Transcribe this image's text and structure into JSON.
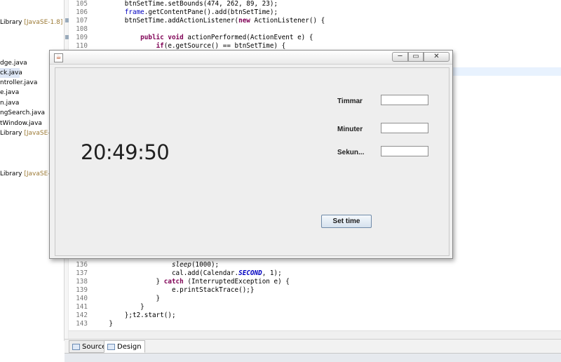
{
  "explorer": {
    "items": [
      {
        "text": " Library ",
        "lib": "[JavaSE-1.8]"
      },
      {
        "text": "dge.java",
        "lib": ""
      },
      {
        "text": "ck.java",
        "lib": ""
      },
      {
        "text": "ntroller.java",
        "lib": ""
      },
      {
        "text": "e.java",
        "lib": ""
      },
      {
        "text": "n.java",
        "lib": ""
      },
      {
        "text": "ngSearch.java",
        "lib": ""
      },
      {
        "text": "tWindow.java",
        "lib": ""
      },
      {
        "text": " Library ",
        "lib": "[JavaSE-"
      },
      {
        "text": " Library ",
        "lib": "[JavaSE-"
      }
    ]
  },
  "code": {
    "l105": {
      "num": "105",
      "text": "        btnSetTime.setBounds(474, 262, 89, 23);"
    },
    "l106": {
      "num": "106",
      "pre": "        ",
      "fld": "frame",
      "post": ".getContentPane().add(btnSetTime);"
    },
    "l107": {
      "num": "107",
      "pre": "        btnSetTime.addActionListener(",
      "kw": "new",
      "post": " ActionListener() {"
    },
    "l108": {
      "num": "108"
    },
    "l109": {
      "num": "109",
      "pre": "            ",
      "kw": "public void",
      "post": " actionPerformed(ActionEvent e) {"
    },
    "l110": {
      "num": "110",
      "pre": "                ",
      "kw": "if",
      "post": "(e.getSource() == btnSetTime) {"
    },
    "l136": {
      "num": "136",
      "pre": "                    ",
      "it": "sleep",
      "post": "(1000);"
    },
    "l137": {
      "num": "137",
      "pre": "                    cal.add(Calendar.",
      "static": "SECOND",
      "post": ", 1);"
    },
    "l138": {
      "num": "138",
      "pre": "                } ",
      "kw": "catch",
      "post": " (InterruptedException e) {"
    },
    "l139": {
      "num": "139",
      "text": "                    e.printStackTrace();}"
    },
    "l140": {
      "num": "140",
      "text": "                }"
    },
    "l141": {
      "num": "141",
      "text": "            }"
    },
    "l142": {
      "num": "142",
      "text": "        };t2.start();"
    },
    "l143": {
      "num": "143",
      "text": "    }"
    }
  },
  "tabs": {
    "source": "Source",
    "design": "Design"
  },
  "window": {
    "java_icon": "java-cup-icon",
    "minimize": "─",
    "maximize": "▭",
    "close": "✕",
    "clock": "20:49:50",
    "fields": {
      "hours_label": "Timmar",
      "minutes_label": "Minuter",
      "seconds_label": "Sekun...",
      "hours_value": "",
      "minutes_value": "",
      "seconds_value": ""
    },
    "set_button": "Set time"
  }
}
